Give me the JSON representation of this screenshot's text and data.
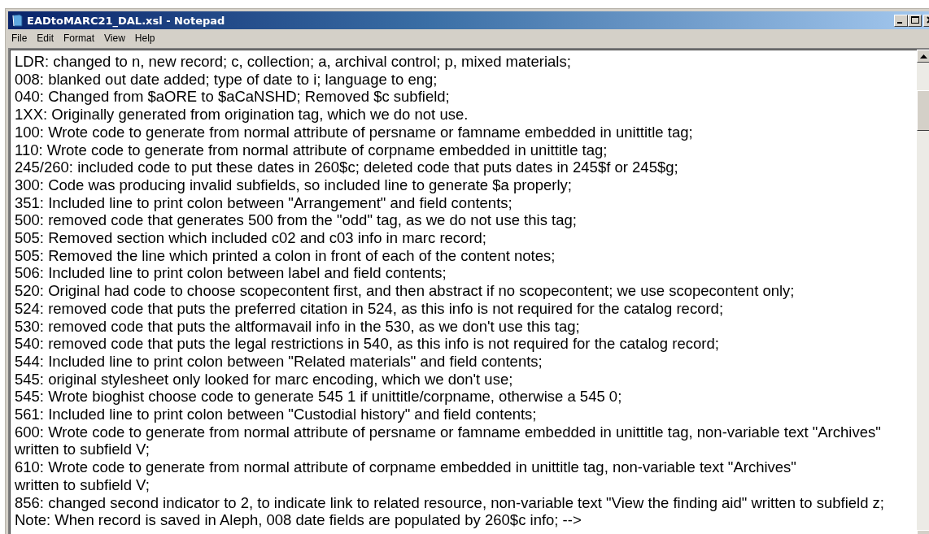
{
  "window": {
    "title": "EADtoMARC21_DAL.xsl - Notepad"
  },
  "menu": [
    "File",
    "Edit",
    "Format",
    "View",
    "Help"
  ],
  "lines": [
    "LDR: changed to n, new record; c, collection; a, archival control; p, mixed materials;",
    "008: blanked out date added; type of date to i; language to eng;",
    "040: Changed from $aORE to $aCaNSHD; Removed $c subfield;",
    "1XX: Originally generated from origination tag, which we do not use.",
    "100: Wrote code to generate from normal attribute of persname or famname embedded in unittitle tag;",
    "110: Wrote code to generate from normal attribute of corpname embedded in unittitle tag;",
    "245/260: included code to put these dates in 260$c; deleted code that puts dates in 245$f or 245$g;",
    "300: Code was producing invalid subfields, so included line to generate $a properly;",
    "351: Included line to print colon between \"Arrangement\" and field contents;",
    "500: removed code that generates 500 from the \"odd\" tag, as we do not use this tag;",
    "505: Removed section which included c02 and c03 info in marc record;",
    "505: Removed the line which printed a colon in front of each of the content notes;",
    "506: Included line to print colon between label and field contents;",
    "520: Original had code to choose scopecontent first, and then abstract if no scopecontent; we use scopecontent only;",
    "524: removed code that puts the preferred citation in 524, as this info is not required for the catalog record;",
    "530: removed code that puts the altformavail info in the 530, as we don't use this tag;",
    "540: removed code that puts the legal restrictions in 540, as this info is not required for the catalog record;",
    "544: Included line to print colon between \"Related materials\" and field contents;",
    "545: original stylesheet only looked for marc encoding, which we don't use;",
    "545: Wrote bioghist choose code to generate 545 1 if unittitle/corpname, otherwise a 545 0;",
    "561: Included line to print colon between \"Custodial history\" and field contents;",
    "600: Wrote code to generate from normal attribute of persname or famname embedded in unittitle tag, non-variable text \"Archives\"",
    "written to subfield V;",
    "610: Wrote code to generate from normal attribute of corpname embedded in unittitle tag, non-variable text \"Archives\"",
    "written to subfield V;",
    "856: changed second indicator to 2, to indicate link to related resource, non-variable text \"View the finding aid\" written to subfield z;",
    "Note: When record is saved in Aleph, 008 date fields are populated by 260$c info; -->"
  ]
}
